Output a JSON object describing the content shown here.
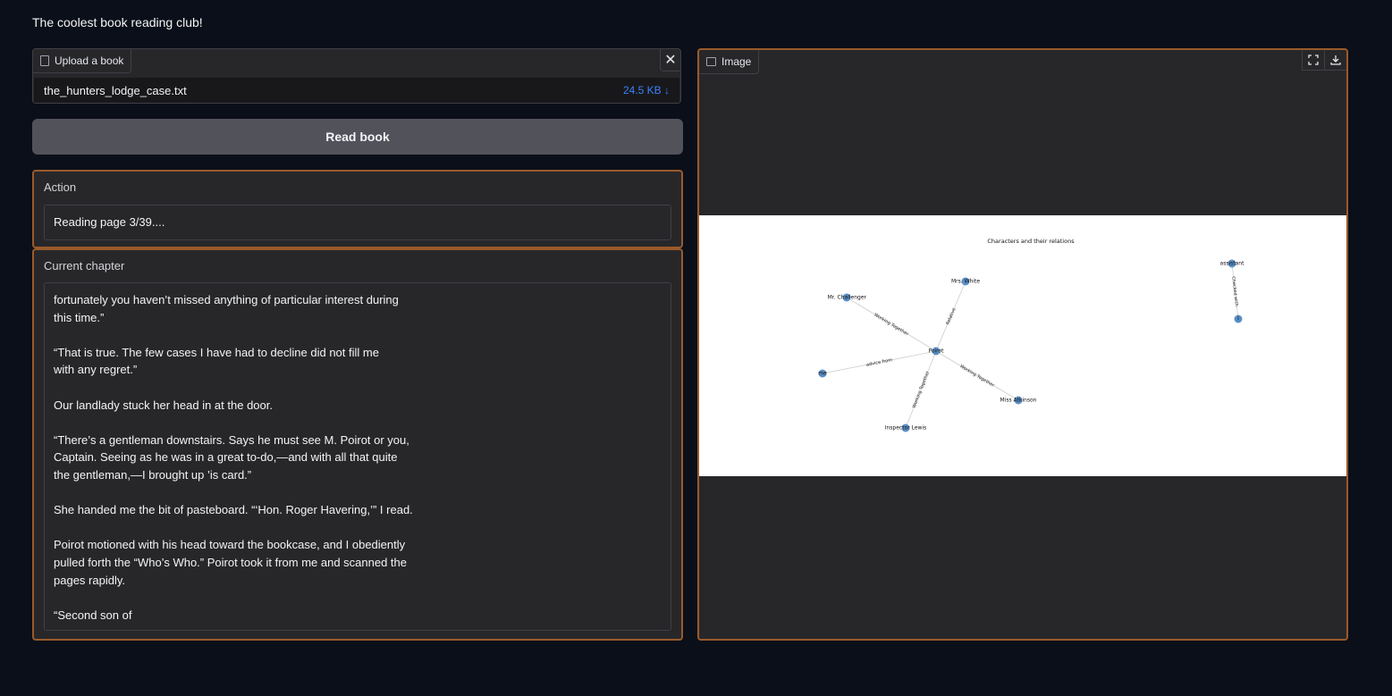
{
  "app": {
    "title": "The coolest book reading club!"
  },
  "upload": {
    "label": "Upload a book",
    "close_glyph": "✕",
    "file_name": "the_hunters_lodge_case.txt",
    "file_size": "24.5 KB ↓"
  },
  "read_button": {
    "label": "Read book"
  },
  "action": {
    "label": "Action",
    "value": "Reading page 3/39...."
  },
  "chapter": {
    "label": "Current chapter",
    "text": "fortunately you haven’t missed anything of particular interest during\nthis time.”\n\n“That is true. The few cases I have had to decline did not fill me\nwith any regret.”\n\nOur landlady stuck her head in at the door.\n\n“There’s a gentleman downstairs. Says he must see M. Poirot or you,\nCaptain. Seeing as he was in a great to-do,—and with all that quite\nthe gentleman,—I brought up ’is card.”\n\nShe handed me the bit of pasteboard. “‘Hon. Roger Havering,’” I read.\n\nPoirot motioned with his head toward the bookcase, and I obediently\npulled forth the “Who’s Who.” Poirot took it from me and scanned the\npages rapidly.\n\n“Second son of"
  },
  "image": {
    "label": "Image",
    "fullscreen_icon": "fullscreen-icon",
    "download_icon": "download-icon",
    "graph": {
      "title": "Characters and their relations",
      "node_color": "#5b8fc7",
      "edge_color": "#cccccc",
      "nodes": [
        {
          "id": "poirot",
          "label": "Poirot"
        },
        {
          "id": "white",
          "label": "Mrs. White"
        },
        {
          "id": "challenger",
          "label": "Mr. Challenger"
        },
        {
          "id": "me",
          "label": "me"
        },
        {
          "id": "lewis",
          "label": "Inspector Lewis"
        },
        {
          "id": "atkinson",
          "label": "Miss Atkinson"
        },
        {
          "id": "assistant",
          "label": "assistant"
        },
        {
          "id": "i",
          "label": "I"
        }
      ],
      "edges": [
        {
          "from": "poirot",
          "to": "white",
          "label": "Relative"
        },
        {
          "from": "poirot",
          "to": "challenger",
          "label": "Working Together"
        },
        {
          "from": "poirot",
          "to": "me",
          "label": "advice from"
        },
        {
          "from": "poirot",
          "to": "lewis",
          "label": "Working Together"
        },
        {
          "from": "poirot",
          "to": "atkinson",
          "label": "Working Together"
        },
        {
          "from": "assistant",
          "to": "i",
          "label": "Checked with"
        }
      ]
    }
  }
}
